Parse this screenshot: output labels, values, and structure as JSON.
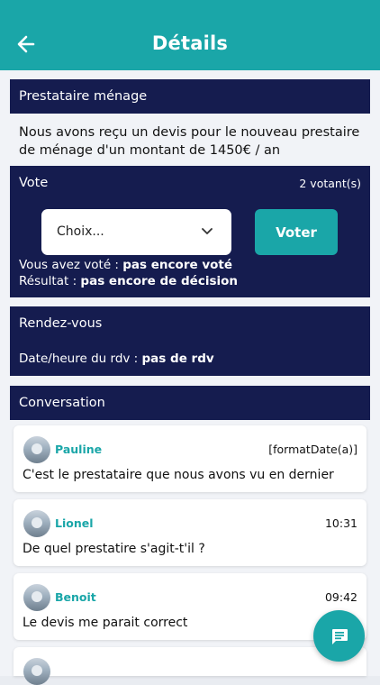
{
  "header": {
    "title": "Détails"
  },
  "section": {
    "title": "Prestataire ménage"
  },
  "description": "Nous avons reçu un devis pour le nouveau prestaire de ménage d'un montant de 1450€ / an",
  "vote": {
    "label": "Vote",
    "voters": "2 votant(s)",
    "select_value": "Choix...",
    "button": "Voter",
    "voted_label": "Vous avez voté : ",
    "voted_value": "pas encore voté",
    "result_label": "Résultat : ",
    "result_value": "pas encore de décision"
  },
  "rdv": {
    "title": "Rendez-vous",
    "label": "Date/heure du rdv : ",
    "value": "pas de rdv"
  },
  "conversation": {
    "title": "Conversation",
    "messages": [
      {
        "author": "Pauline",
        "time": "[formatDate(a)]",
        "text": "C'est le prestataire que nous avons vu en dernier"
      },
      {
        "author": "Lionel",
        "time": "10:31",
        "text": "De quel prestatire s'agit-t'il ?"
      },
      {
        "author": "Benoit",
        "time": "09:42",
        "text": "Le devis me parait correct"
      }
    ]
  },
  "icons": {
    "back": "arrow-left-icon",
    "chevron": "chevron-down-icon",
    "fab": "chat-icon"
  },
  "colors": {
    "primary": "#1aa6a8",
    "navy": "#151c4f"
  }
}
